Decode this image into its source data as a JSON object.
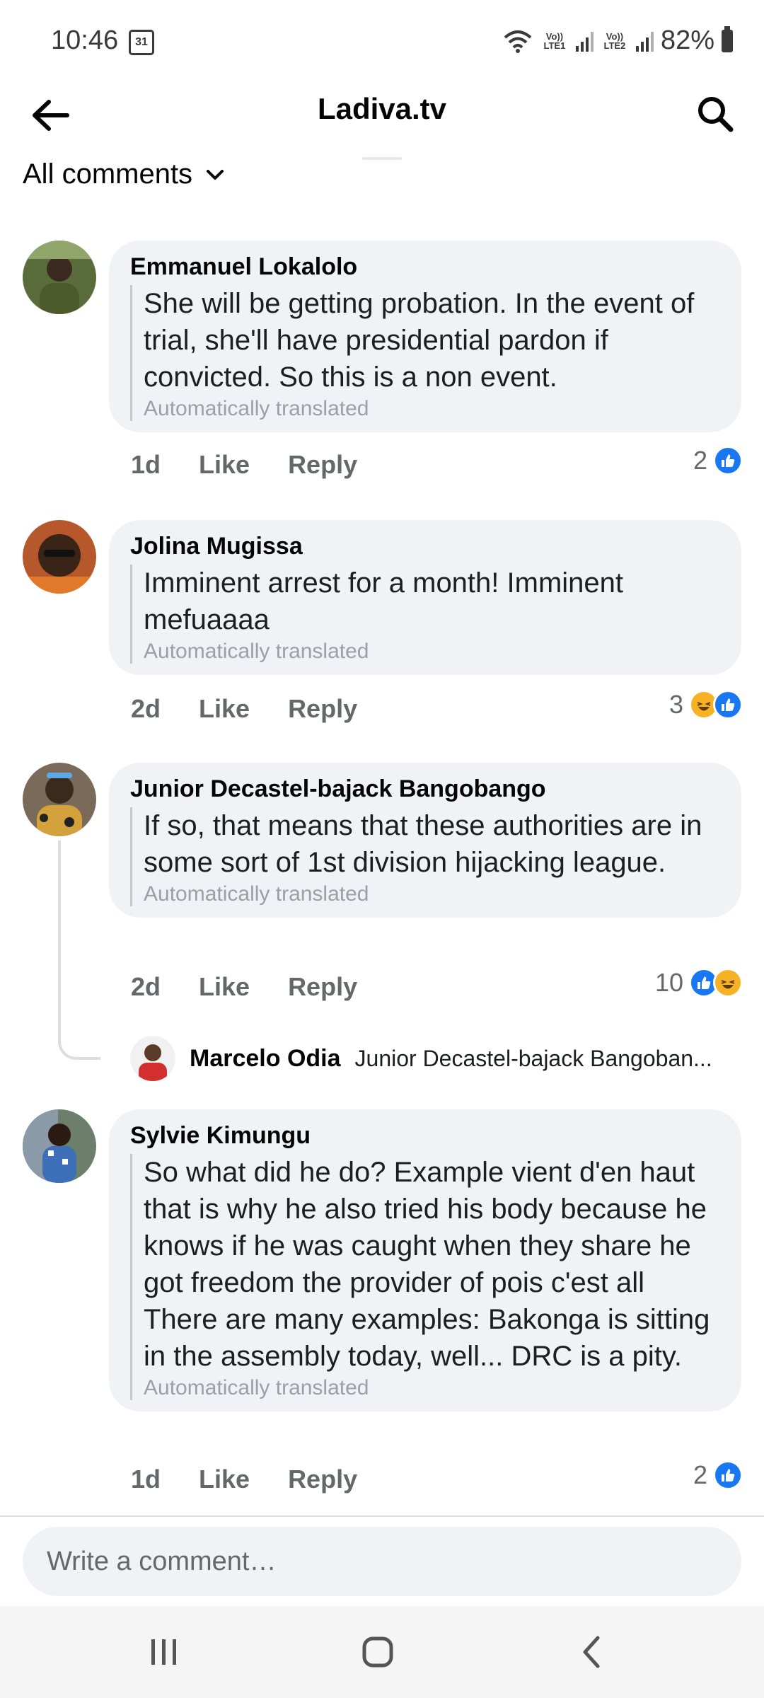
{
  "status_bar": {
    "time": "10:46",
    "calendar_day": "31",
    "sim1_label": "Vo)) LTE1",
    "sim2_label": "Vo)) LTE2",
    "battery": "82%"
  },
  "header": {
    "title": "Ladiva.tv"
  },
  "filter": {
    "label": "All comments"
  },
  "comments": [
    {
      "author": "Emmanuel Lokalolo",
      "text": "She will be getting probation. In the event of trial, she'll have presidential pardon if convicted. So this is a non event.",
      "translated": "Automatically translated",
      "time": "1d",
      "like": "Like",
      "reply": "Reply",
      "reaction_count": "2",
      "reactions": [
        "like-icon"
      ]
    },
    {
      "author": "Jolina Mugissa",
      "text": "Imminent arrest for a month! Imminent mefuaaaa",
      "translated": "Automatically translated",
      "time": "2d",
      "like": "Like",
      "reply": "Reply",
      "reaction_count": "3",
      "reactions": [
        "haha-icon",
        "like-icon"
      ]
    },
    {
      "author": "Junior Decastel-bajack Bangobango",
      "text": "If so, that means that these authorities are in some sort of 1st division hijacking league.",
      "translated": "Automatically translated",
      "time": "2d",
      "like": "Like",
      "reply": "Reply",
      "reaction_count": "10",
      "reactions": [
        "like-icon",
        "haha-icon"
      ]
    },
    {
      "author": "Sylvie Kimungu",
      "text": "So what did he do? Example vient d'en haut that is why he also tried his body because he knows if he was caught when they share he got freedom the provider of pois c'est all There are many examples: Bakonga is sitting in the assembly today, well... DRC is a pity.",
      "translated": "Automatically translated",
      "time": "1d",
      "like": "Like",
      "reply": "Reply",
      "reaction_count": "2",
      "reactions": [
        "like-icon"
      ]
    }
  ],
  "reply_preview": {
    "author": "Marcelo Odia",
    "text": "Junior Decastel-bajack Bangoban..."
  },
  "composer": {
    "placeholder": "Write a comment…"
  },
  "colors": {
    "like_blue": "#1877f2",
    "bubble_bg": "#f0f2f5",
    "meta_gray": "#65676b",
    "haha_yellow": "#f7b125"
  }
}
